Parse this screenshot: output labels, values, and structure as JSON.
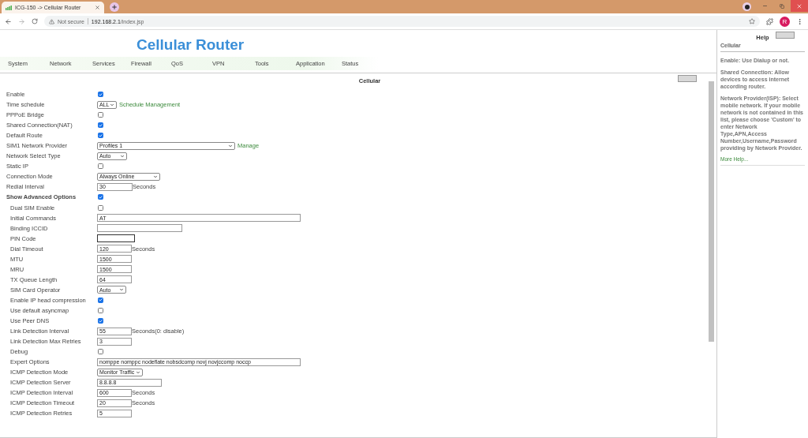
{
  "browser": {
    "tab_title": "ICG-150 -> Cellular Router",
    "security": "Not secure",
    "url_host": "192.168.2.1",
    "url_path": "/index.jsp",
    "profile_initial": "R"
  },
  "page": {
    "title": "Cellular Router",
    "nav": [
      "System",
      "Network",
      "Services",
      "Firewall",
      "QoS",
      "VPN",
      "Tools",
      "Application",
      "Status"
    ]
  },
  "panel": {
    "title": "Cellular",
    "fields": [
      {
        "label": "Enable",
        "kind": "checkbox",
        "checked": true
      },
      {
        "label": "Time schedule",
        "kind": "select",
        "value": "ALL",
        "link": "Schedule Management"
      },
      {
        "label": "PPPoE Bridge",
        "kind": "checkbox",
        "checked": false
      },
      {
        "label": "Shared Connection(NAT)",
        "kind": "checkbox",
        "checked": true
      },
      {
        "label": "Default Route",
        "kind": "checkbox",
        "checked": true
      },
      {
        "label": "SIM1 Network Provider",
        "kind": "select",
        "value": "Profiles 1",
        "link": "Manage"
      },
      {
        "label": "Network Select Type",
        "kind": "select",
        "value": "Auto"
      },
      {
        "label": "Static IP",
        "kind": "checkbox",
        "checked": false
      },
      {
        "label": "Connection Mode",
        "kind": "select",
        "value": "Always Online"
      },
      {
        "label": "Redial Interval",
        "kind": "text",
        "value": "30",
        "suffix": "Seconds"
      },
      {
        "label": "Show Advanced Options",
        "kind": "checkbox",
        "checked": true,
        "children": [
          {
            "label": "Dual SIM Enable",
            "kind": "checkbox",
            "checked": false
          },
          {
            "label": "Initial Commands",
            "kind": "text",
            "value": "AT"
          },
          {
            "label": "Binding ICCID",
            "kind": "text"
          },
          {
            "label": "PIN Code",
            "kind": "text"
          },
          {
            "label": "Dial Timeout",
            "kind": "text",
            "value": "120",
            "suffix": "Seconds"
          },
          {
            "label": "MTU",
            "kind": "text",
            "value": "1500"
          },
          {
            "label": "MRU",
            "kind": "text",
            "value": "1500"
          },
          {
            "label": "TX Queue Length",
            "kind": "text",
            "value": "64"
          },
          {
            "label": "SIM Card Operator",
            "kind": "select",
            "value": "Auto"
          },
          {
            "label": "Enable IP head compression",
            "kind": "checkbox",
            "checked": true
          },
          {
            "label": "Use default asyncmap",
            "kind": "checkbox",
            "checked": false
          },
          {
            "label": "Use Peer DNS",
            "kind": "checkbox",
            "checked": true
          },
          {
            "label": "Link Detection Interval",
            "kind": "text",
            "value": "55",
            "suffix": "Seconds(0: disable)"
          },
          {
            "label": "Link Detection Max Retries",
            "kind": "text",
            "value": "3"
          },
          {
            "label": "Debug",
            "kind": "checkbox",
            "checked": false
          },
          {
            "label": "Expert Options",
            "kind": "text",
            "value": "nomppe nomppc nodeflate nobsdcomp novj novjccomp noccp"
          },
          {
            "label": "ICMP Detection Mode",
            "kind": "select",
            "value": "Monitor Traffic"
          },
          {
            "label": "ICMP Detection Server",
            "kind": "text",
            "value": "8.8.8.8"
          },
          {
            "label": "ICMP Detection Interval",
            "kind": "text",
            "value": "600",
            "suffix": "Seconds"
          },
          {
            "label": "ICMP Detection Timeout",
            "kind": "text",
            "value": "20",
            "suffix": "Seconds"
          },
          {
            "label": "ICMP Detection Retries",
            "kind": "text",
            "value": "5"
          }
        ]
      }
    ]
  },
  "help": {
    "title": "Help",
    "section": "Cellular",
    "paragraphs": [
      "Enable: Use Dialup or not.",
      "Shared Connection: Allow devices to access internet according router.",
      "Network Provider(ISP): Select mobile network. If your mobile network is not contained in this list, please choose 'Custom' to enter Network Type,APN,Access Number,Username,Password providing by Network Provider."
    ],
    "link": "More Help..."
  }
}
